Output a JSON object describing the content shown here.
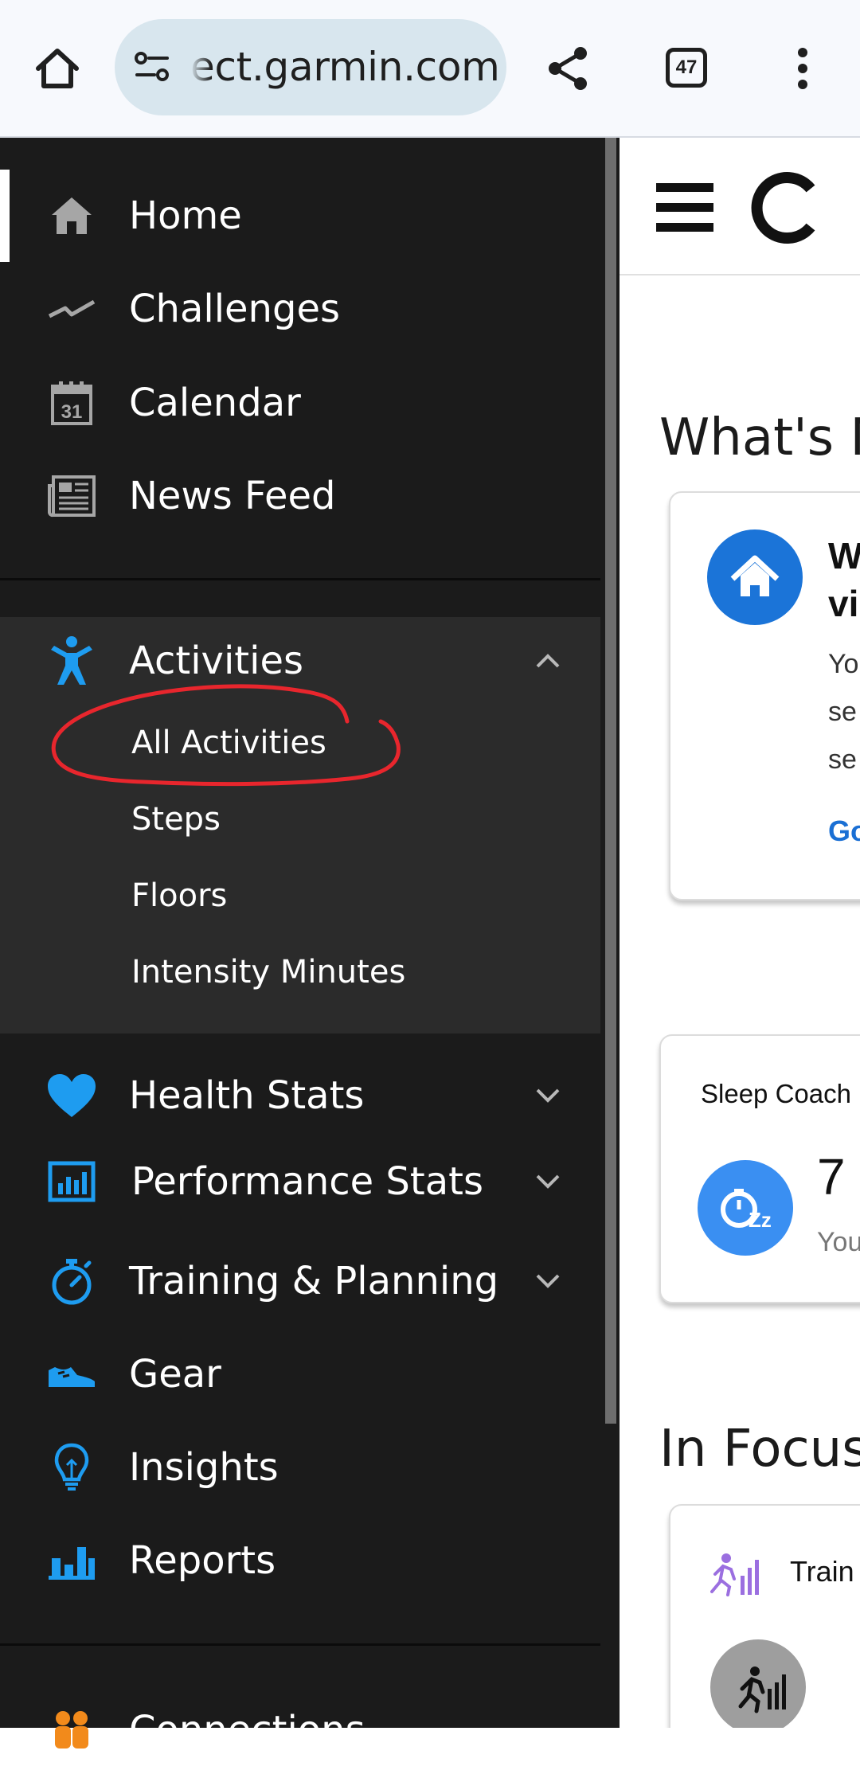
{
  "browser": {
    "url": "ect.garmin.com",
    "tab_count": "47"
  },
  "sidebar": {
    "top_items": [
      {
        "label": "Home",
        "icon": "home-icon"
      },
      {
        "label": "Challenges",
        "icon": "challenges-icon"
      },
      {
        "label": "Calendar",
        "icon": "calendar-icon",
        "icon_text": "31"
      },
      {
        "label": "News Feed",
        "icon": "newspaper-icon"
      }
    ],
    "activities": {
      "label": "Activities",
      "icon": "activities-figure-icon",
      "expanded": true,
      "sub_items": [
        "All Activities",
        "Steps",
        "Floors",
        "Intensity Minutes"
      ]
    },
    "stat_items": [
      {
        "label": "Health Stats",
        "icon": "heart-icon"
      },
      {
        "label": "Performance Stats",
        "icon": "performance-chart-icon"
      },
      {
        "label": "Training & Planning",
        "icon": "stopwatch-icon"
      },
      {
        "label": "Gear",
        "icon": "shoe-icon"
      },
      {
        "label": "Insights",
        "icon": "lightbulb-icon"
      },
      {
        "label": "Reports",
        "icon": "bar-chart-icon"
      }
    ],
    "bottom_item": {
      "label": "Connections",
      "icon": "connections-icon"
    },
    "annotation_color": "#e8262d",
    "accent_color": "#119ef5"
  },
  "main": {
    "whats_new_heading": "What's N",
    "whats_new_card": {
      "title_line1": "W",
      "title_line2": "vi",
      "body_lines": [
        "Yo",
        "se",
        "se"
      ],
      "link": "Go"
    },
    "sleep_card": {
      "title": "Sleep Coach",
      "value": "7",
      "sub": "You"
    },
    "in_focus_heading": "In Focus",
    "in_focus_card": {
      "title": "Train"
    }
  }
}
